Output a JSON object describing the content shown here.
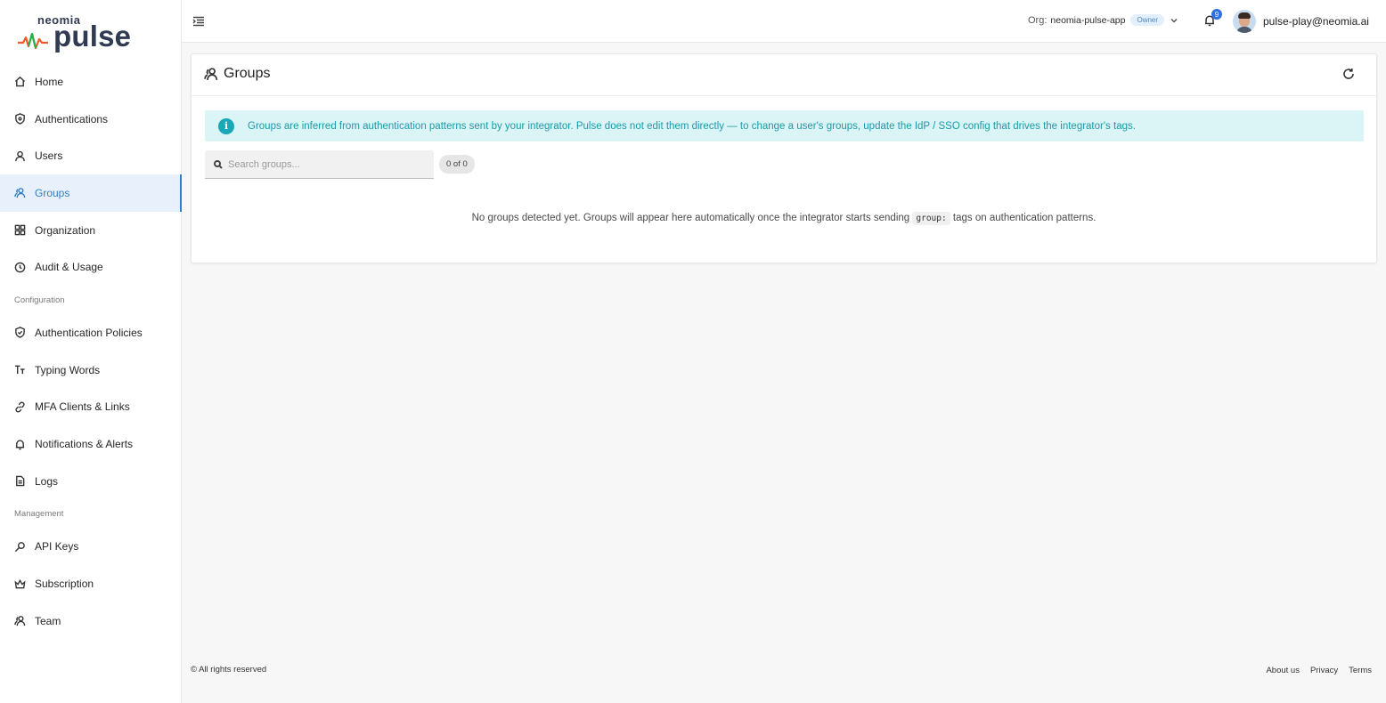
{
  "brand": {
    "top": "neomia",
    "main": "pulse"
  },
  "sidebar": {
    "items": [
      {
        "label": "Home",
        "icon": "home-icon"
      },
      {
        "label": "Authentications",
        "icon": "shield-icon"
      },
      {
        "label": "Users",
        "icon": "user-icon"
      },
      {
        "label": "Groups",
        "icon": "users-icon",
        "active": true
      },
      {
        "label": "Organization",
        "icon": "grid-icon"
      },
      {
        "label": "Audit & Usage",
        "icon": "clock-icon"
      }
    ],
    "section_config": "Configuration",
    "config_items": [
      {
        "label": "Authentication Policies",
        "icon": "shield-check-icon"
      },
      {
        "label": "Typing Words",
        "icon": "text-icon"
      },
      {
        "label": "MFA Clients & Links",
        "icon": "link-icon"
      },
      {
        "label": "Notifications & Alerts",
        "icon": "bell-icon"
      },
      {
        "label": "Logs",
        "icon": "file-icon"
      }
    ],
    "section_management": "Management",
    "management_items": [
      {
        "label": "API Keys",
        "icon": "key-icon"
      },
      {
        "label": "Subscription",
        "icon": "crown-icon"
      },
      {
        "label": "Team",
        "icon": "team-icon"
      }
    ]
  },
  "topbar": {
    "org_label": "Org:",
    "org_name": "neomia-pulse-app",
    "org_role": "Owner",
    "notification_count": "9",
    "user_email": "pulse-play@neomia.ai"
  },
  "page": {
    "title": "Groups",
    "info": "Groups are inferred from authentication patterns sent by your integrator. Pulse does not edit them directly — to change a user's groups, update the IdP / SSO config that drives the integrator's tags.",
    "search_placeholder": "Search groups...",
    "count": "0 of 0",
    "empty_before": "No groups detected yet. Groups will appear here automatically once the integrator starts sending",
    "empty_code": "group:",
    "empty_after": "tags on authentication patterns."
  },
  "footer": {
    "copyright": "© All rights reserved",
    "links": [
      "About us",
      "Privacy",
      "Terms"
    ]
  },
  "colors": {
    "accent": "#2f7ec7",
    "info_bg": "#dbf4f6",
    "info_text": "#1d9aa8",
    "badge": "#2f6fe0"
  }
}
